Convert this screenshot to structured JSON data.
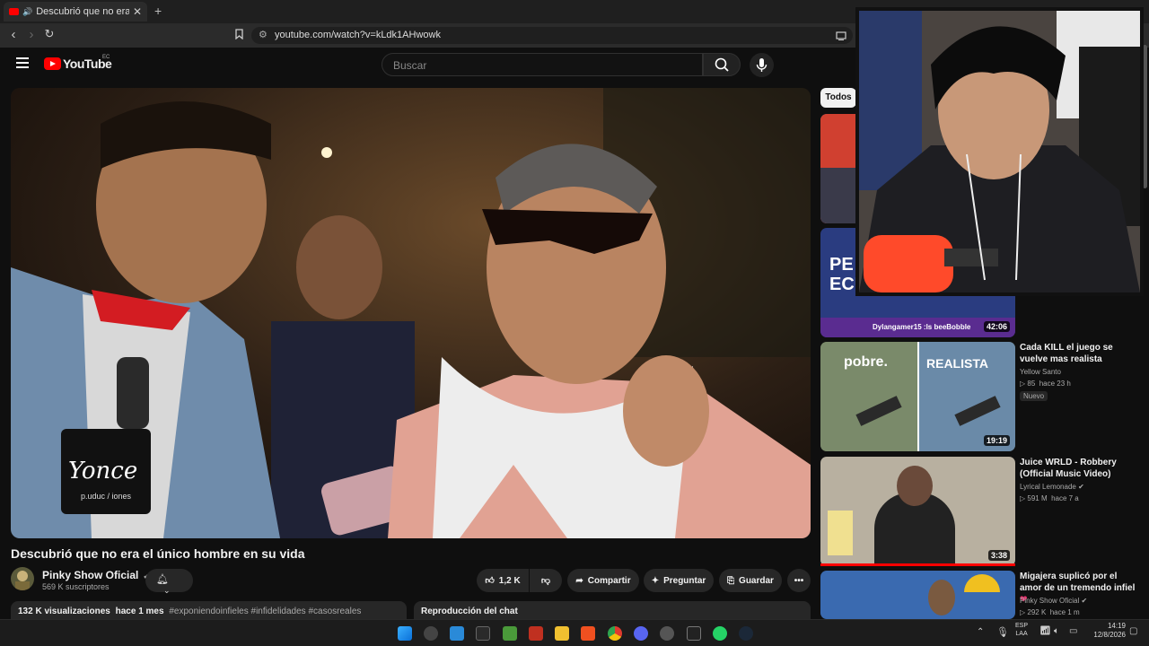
{
  "browser": {
    "tab_title": "Descubrió que no era el único",
    "new_tab": "+",
    "url": "youtube.com/watch?v=kLdk1AHwowk"
  },
  "header": {
    "logo_text": "YouTube",
    "country_code": "EC",
    "search_placeholder": "Buscar"
  },
  "video": {
    "title": "Descubrió que no era el único hombre en su vida",
    "channel": "Pinky Show Oficial",
    "subscribers": "569 K suscriptores",
    "likes": "1,2 K",
    "share_label": "Compartir",
    "ask_label": "Preguntar",
    "save_label": "Guardar",
    "views": "132 K visualizaciones",
    "posted": "hace 1 mes",
    "hashtags": "#exponiendoinfieles #infidelidades #casosreales",
    "chat_replay": "Reproducción del chat",
    "mic_logo_text": "Yonce",
    "mic_logo_sub": "p.uduc / iones"
  },
  "sidebar": {
    "chip_all": "Todos",
    "items": [
      {
        "duration": "",
        "thumb_color": "#6a8fc4"
      },
      {
        "duration": "42:06",
        "overlay_text": "Dylangamer15 :ls beeBobble",
        "thumb_text": "PE ECU"
      },
      {
        "title": "Cada KILL el juego se vuelve mas realista",
        "channel": "Yellow Santo",
        "views": "85",
        "age": "hace 23 h",
        "badge": "Nuevo",
        "duration": "19:19",
        "thumb_left": "pobre.",
        "thumb_right": "REALISTA"
      },
      {
        "title": "Juice WRLD - Robbery (Official Music Video)",
        "channel": "Lyrical Lemonade",
        "views": "591 M",
        "age": "hace 7 a",
        "duration": "3:38"
      },
      {
        "title": "Migajera suplicó por el amor de un tremendo infiel",
        "channel": "Pinky Show Oficial",
        "views": "292 K",
        "age": "hace 1 m",
        "heart": "❤"
      }
    ]
  },
  "taskbar": {
    "lang": "ESP",
    "lang_sub": "LAA",
    "time": "14:19",
    "date": "12/8/2026"
  },
  "colors": {
    "yt_red": "#ff0000",
    "bg": "#0f0f0f",
    "pill": "#272727"
  }
}
